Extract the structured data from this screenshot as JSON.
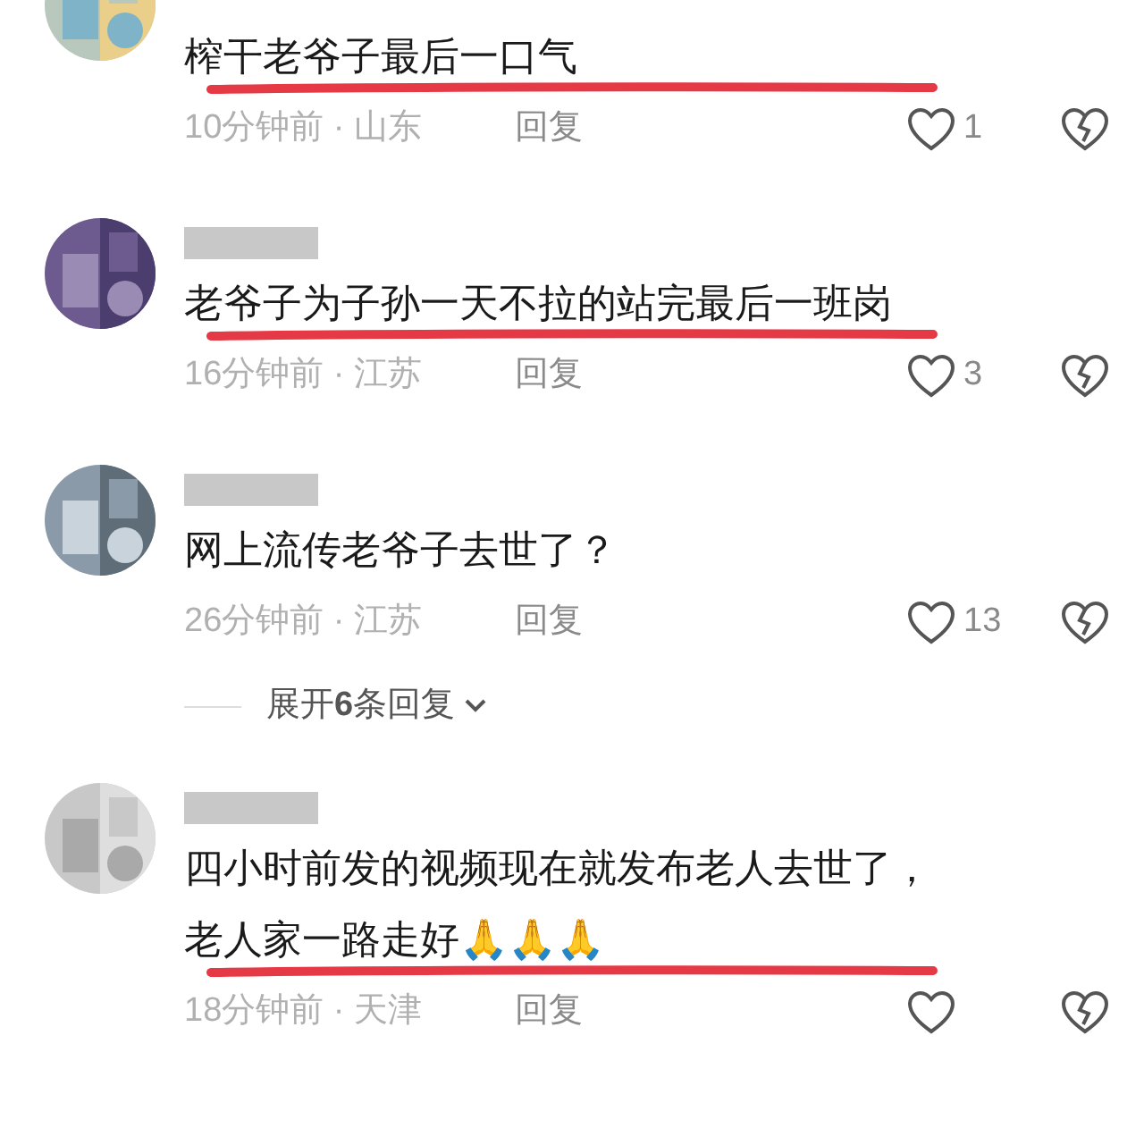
{
  "comments": [
    {
      "name_redacted": false,
      "text": [
        "榨干老爷子最后一口气"
      ],
      "time_location": "10分钟前 · 山东",
      "reply": "回复",
      "likes": "1",
      "underlined": true
    },
    {
      "name_redacted": true,
      "text": [
        "老爷子为子孙一天不拉的站完最后一班岗"
      ],
      "time_location": "16分钟前 · 江苏",
      "reply": "回复",
      "likes": "3",
      "underlined": true
    },
    {
      "name_redacted": true,
      "text": [
        "网上流传老爷子去世了？"
      ],
      "time_location": "26分钟前 · 江苏",
      "reply": "回复",
      "likes": "13",
      "underlined": false,
      "expand": "展开**6**条回复"
    },
    {
      "name_redacted": true,
      "text": [
        "四小时前发的视频现在就发布老人去世了，",
        "老人家一路走好🙏🙏🙏"
      ],
      "time_location": "18分钟前 · 天津",
      "reply": "回复",
      "underlined": true
    }
  ]
}
